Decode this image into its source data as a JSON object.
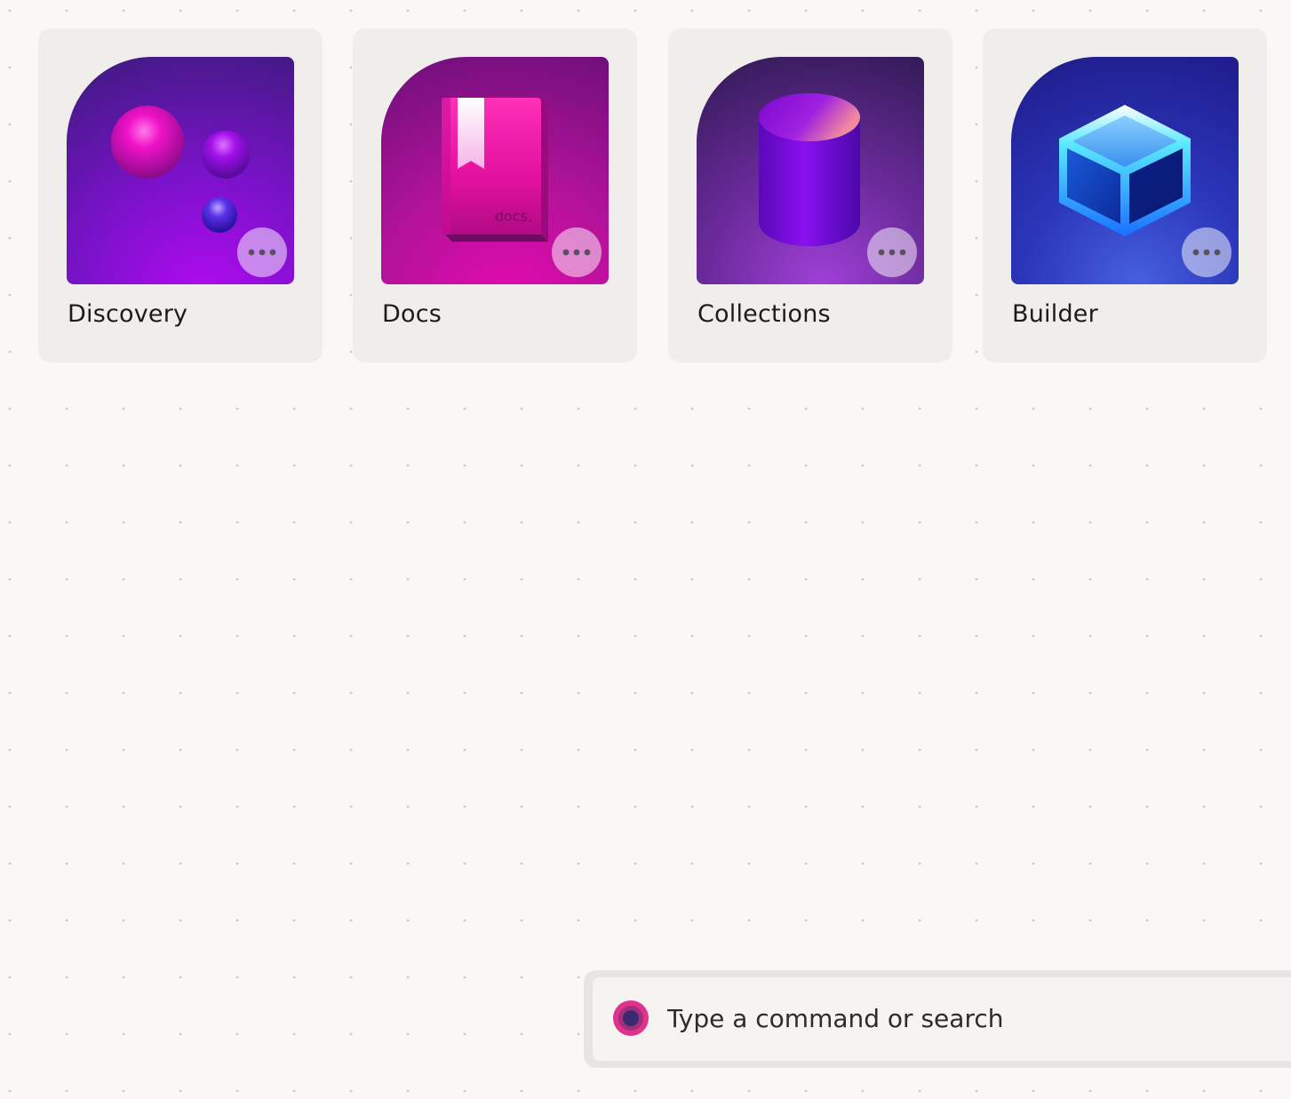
{
  "apps": [
    {
      "label": "Discovery",
      "icon": "spheres-icon"
    },
    {
      "label": "Docs",
      "icon": "book-icon",
      "book_text": "docs."
    },
    {
      "label": "Collections",
      "icon": "database-icon"
    },
    {
      "label": "Builder",
      "icon": "cube-icon"
    }
  ],
  "command_bar": {
    "placeholder": "Type a command or search"
  },
  "colors": {
    "background": "#f9f8f6",
    "card": "#f0eeeb",
    "discovery_gradient": [
      "#2e1d6b",
      "#7a12c9",
      "#b10af0"
    ],
    "docs_gradient": [
      "#6b0f7a",
      "#c4119a",
      "#e50ab0"
    ],
    "collections_gradient": [
      "#2a1850",
      "#5a2a8a",
      "#9a3ed0"
    ],
    "builder_gradient": [
      "#1e1e8a",
      "#2a2fb0",
      "#3d5be0"
    ],
    "accent_pink": "#e0338f"
  }
}
